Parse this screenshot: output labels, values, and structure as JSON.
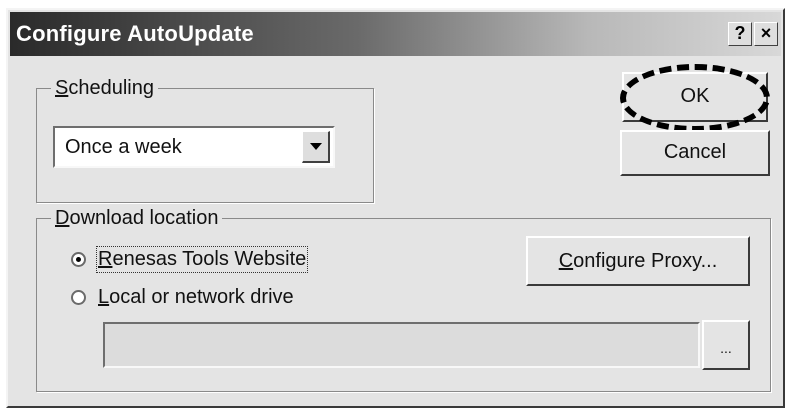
{
  "window": {
    "title": "Configure AutoUpdate",
    "help_glyph": "?",
    "close_glyph": "×"
  },
  "scheduling": {
    "label": "Scheduling",
    "selected": "Once a week"
  },
  "buttons": {
    "ok": "OK",
    "cancel": "Cancel",
    "configure_proxy": "Configure Proxy...",
    "browse": "..."
  },
  "download": {
    "label": "Download location",
    "options": [
      {
        "label": "Renesas Tools Website",
        "selected": true
      },
      {
        "label": "Local or network drive",
        "selected": false
      }
    ],
    "path_value": ""
  },
  "icons": {
    "dropdown": "chevron-down-icon",
    "help": "help-icon",
    "close": "close-icon"
  },
  "colors": {
    "dialog_bg": "#e4e4e4",
    "title_start": "#2a2a2a",
    "title_end": "#d8d8d8"
  }
}
